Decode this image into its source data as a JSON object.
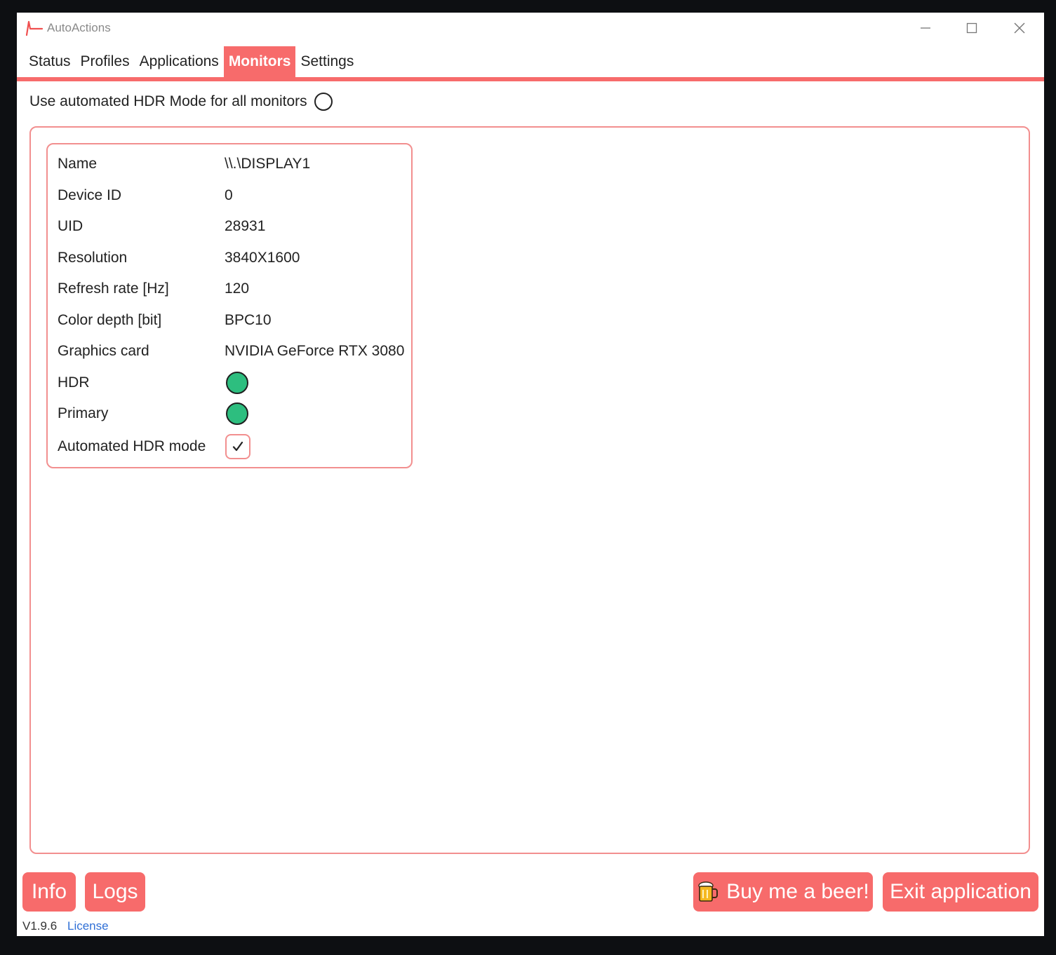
{
  "window": {
    "title": "AutoActions",
    "accent_color": "#f76b6b",
    "border_color": "#f28f8f"
  },
  "tabs": [
    {
      "label": "Status",
      "active": false
    },
    {
      "label": "Profiles",
      "active": false
    },
    {
      "label": "Applications",
      "active": false
    },
    {
      "label": "Monitors",
      "active": true
    },
    {
      "label": "Settings",
      "active": false
    }
  ],
  "global_option": {
    "label": "Use automated HDR Mode for all monitors",
    "checked": false
  },
  "monitor": {
    "name_label": "Name",
    "name_value": "\\\\.\\DISPLAY1",
    "device_id_label": "Device ID",
    "device_id_value": "0",
    "uid_label": "UID",
    "uid_value": "28931",
    "resolution_label": "Resolution",
    "resolution_value": "3840X1600",
    "refresh_label": "Refresh rate [Hz]",
    "refresh_value": "120",
    "color_depth_label": "Color depth [bit]",
    "color_depth_value": "BPC10",
    "graphics_label": "Graphics card",
    "graphics_value": "NVIDIA GeForce RTX 3080",
    "hdr_label": "HDR",
    "hdr_on": true,
    "primary_label": "Primary",
    "primary_on": true,
    "auto_hdr_label": "Automated HDR mode",
    "auto_hdr_checked": true,
    "indicator_color": "#2dbe7f"
  },
  "footer": {
    "info_label": "Info",
    "logs_label": "Logs",
    "beer_label": "Buy me a beer!",
    "beer_icon": "beer-mug-icon",
    "exit_label": "Exit application",
    "version": "V1.9.6",
    "license_label": "License"
  }
}
